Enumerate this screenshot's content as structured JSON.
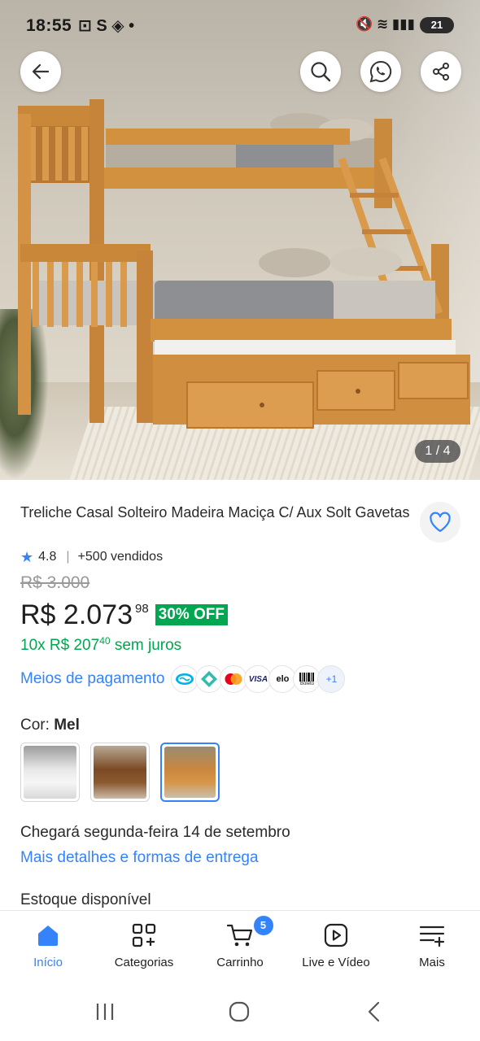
{
  "status_bar": {
    "time": "18:55",
    "left_icons": "⊡ S ◈ •",
    "right_icons": "🔇 ≋ ▮▮▮",
    "battery": "21"
  },
  "gallery": {
    "counter": "1 / 4",
    "icons": [
      "back-arrow-icon",
      "search-icon",
      "whatsapp-icon",
      "share-icon"
    ]
  },
  "product": {
    "title": "Treliche Casal Solteiro Madeira Maciça C/ Aux Solt Gavetas",
    "rating": "4.8",
    "sold": "+500 vendidos",
    "old_price": "R$ 3.000",
    "price": "R$ 2.073",
    "price_cents": "98",
    "discount": "30% OFF",
    "installments_prefix": "10x R$ 207",
    "installments_cents": "40",
    "installments_suffix": " sem juros",
    "payment_link": "Meios de pagamento",
    "payment_methods": [
      "mercado-pago",
      "pix",
      "mastercard",
      "VISA",
      "elo",
      "Boleto"
    ],
    "payment_more": "+1",
    "color_label": "Cor:",
    "color_value": "Mel",
    "delivery": "Chegará segunda-feira 14 de setembro",
    "delivery_link": "Mais detalhes e formas de entrega",
    "stock": "Estoque disponível"
  },
  "bottom_nav": {
    "items": [
      {
        "label": "Início",
        "icon": "home-icon",
        "active": true
      },
      {
        "label": "Categorias",
        "icon": "categories-icon",
        "active": false
      },
      {
        "label": "Carrinho",
        "icon": "cart-icon",
        "active": false
      },
      {
        "label": "Live e Vídeo",
        "icon": "video-icon",
        "active": false
      },
      {
        "label": "Mais",
        "icon": "menu-more-icon",
        "active": false
      }
    ],
    "cart_count": "5"
  },
  "colors": {
    "accent": "#3483fa",
    "green": "#00a650"
  }
}
